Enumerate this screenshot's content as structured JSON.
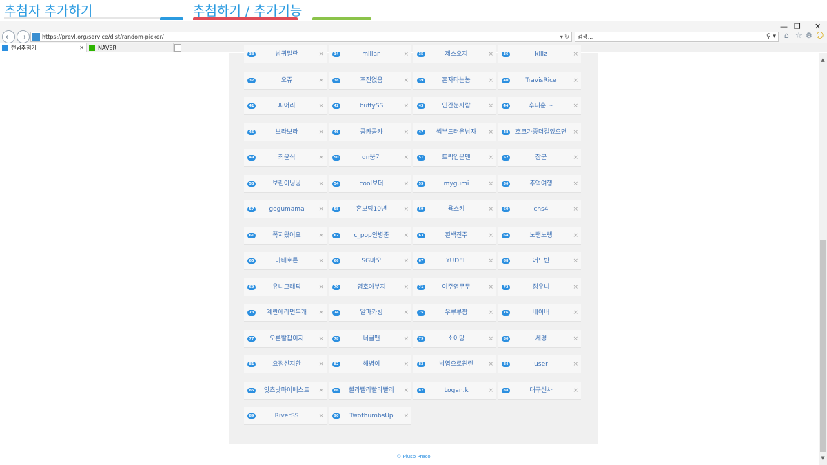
{
  "header": {
    "title_left": "추첨자 추가하기",
    "title_mid": "추첨하기 / 추가기능",
    "colors": {
      "accent": "#2b9be0",
      "bar_blue": "#2b9be0",
      "bar_red": "#e04b57",
      "bar_green": "#8bc34a"
    }
  },
  "browser": {
    "url": "https://prevl.org/service/dist/random-picker/",
    "search_placeholder": "검색...",
    "tabs": [
      {
        "label": "랜덤추첨기",
        "active": true,
        "favicon_color": "#2b8fe0"
      },
      {
        "label": "NAVER",
        "active": false,
        "favicon_color": "#2db400"
      }
    ],
    "icons": [
      "back-icon",
      "forward-icon",
      "home-icon",
      "star-icon",
      "gear-icon",
      "smiley-icon"
    ]
  },
  "participants": [
    {
      "n": "33",
      "name": "님귀밀란"
    },
    {
      "n": "34",
      "name": "millan"
    },
    {
      "n": "35",
      "name": "제스오지"
    },
    {
      "n": "36",
      "name": "kiiiz"
    },
    {
      "n": "37",
      "name": "오쥬"
    },
    {
      "n": "38",
      "name": "후진없음"
    },
    {
      "n": "39",
      "name": "혼자타는놈"
    },
    {
      "n": "40",
      "name": "TravisRice"
    },
    {
      "n": "41",
      "name": "피어리"
    },
    {
      "n": "42",
      "name": "buffySS"
    },
    {
      "n": "43",
      "name": "인간눈사람"
    },
    {
      "n": "44",
      "name": "후니훈.~"
    },
    {
      "n": "45",
      "name": "보라보라"
    },
    {
      "n": "46",
      "name": "콩카콩카"
    },
    {
      "n": "47",
      "name": "썩부드러운남자"
    },
    {
      "n": "48",
      "name": "호크가좋더길었으면"
    },
    {
      "n": "49",
      "name": "최윤식"
    },
    {
      "n": "50",
      "name": "dn웅키"
    },
    {
      "n": "51",
      "name": "트릭입문맨"
    },
    {
      "n": "52",
      "name": "참군"
    },
    {
      "n": "53",
      "name": "보린이닝닝"
    },
    {
      "n": "54",
      "name": "cool보더"
    },
    {
      "n": "55",
      "name": "mygumi"
    },
    {
      "n": "56",
      "name": "추억여행"
    },
    {
      "n": "57",
      "name": "gogumama"
    },
    {
      "n": "58",
      "name": "혼보딩10년"
    },
    {
      "n": "59",
      "name": "용스키"
    },
    {
      "n": "60",
      "name": "chs4"
    },
    {
      "n": "61",
      "name": "쪽지왔어요"
    },
    {
      "n": "62",
      "name": "c_pop안병준"
    },
    {
      "n": "63",
      "name": "흰백진주"
    },
    {
      "n": "64",
      "name": "노랭노랭"
    },
    {
      "n": "65",
      "name": "마태호른"
    },
    {
      "n": "66",
      "name": "SG마오"
    },
    {
      "n": "67",
      "name": "YUDEL"
    },
    {
      "n": "68",
      "name": "어드반"
    },
    {
      "n": "69",
      "name": "유니그래픽"
    },
    {
      "n": "70",
      "name": "영호아부지"
    },
    {
      "n": "71",
      "name": "이주영무무"
    },
    {
      "n": "72",
      "name": "정우니"
    },
    {
      "n": "73",
      "name": "계란에라면두개"
    },
    {
      "n": "74",
      "name": "알파카빙"
    },
    {
      "n": "75",
      "name": "우루루꽝"
    },
    {
      "n": "76",
      "name": "네이버"
    },
    {
      "n": "77",
      "name": "오른발잡이지"
    },
    {
      "n": "78",
      "name": "너굴맨"
    },
    {
      "n": "79",
      "name": "소이망"
    },
    {
      "n": "80",
      "name": "세경"
    },
    {
      "n": "81",
      "name": "요정신지환"
    },
    {
      "n": "82",
      "name": "해병이"
    },
    {
      "n": "83",
      "name": "낙엽으로원런"
    },
    {
      "n": "84",
      "name": "user"
    },
    {
      "n": "85",
      "name": "잇츠낫마이베스트"
    },
    {
      "n": "86",
      "name": "빨라빨라빨라빨라"
    },
    {
      "n": "87",
      "name": "Logan.k"
    },
    {
      "n": "88",
      "name": "대구신사"
    },
    {
      "n": "89",
      "name": "RiverSS"
    },
    {
      "n": "90",
      "name": "TwothumbsUp"
    }
  ],
  "remove_glyph": "×",
  "footer": {
    "text": "© Plusb Preco"
  }
}
